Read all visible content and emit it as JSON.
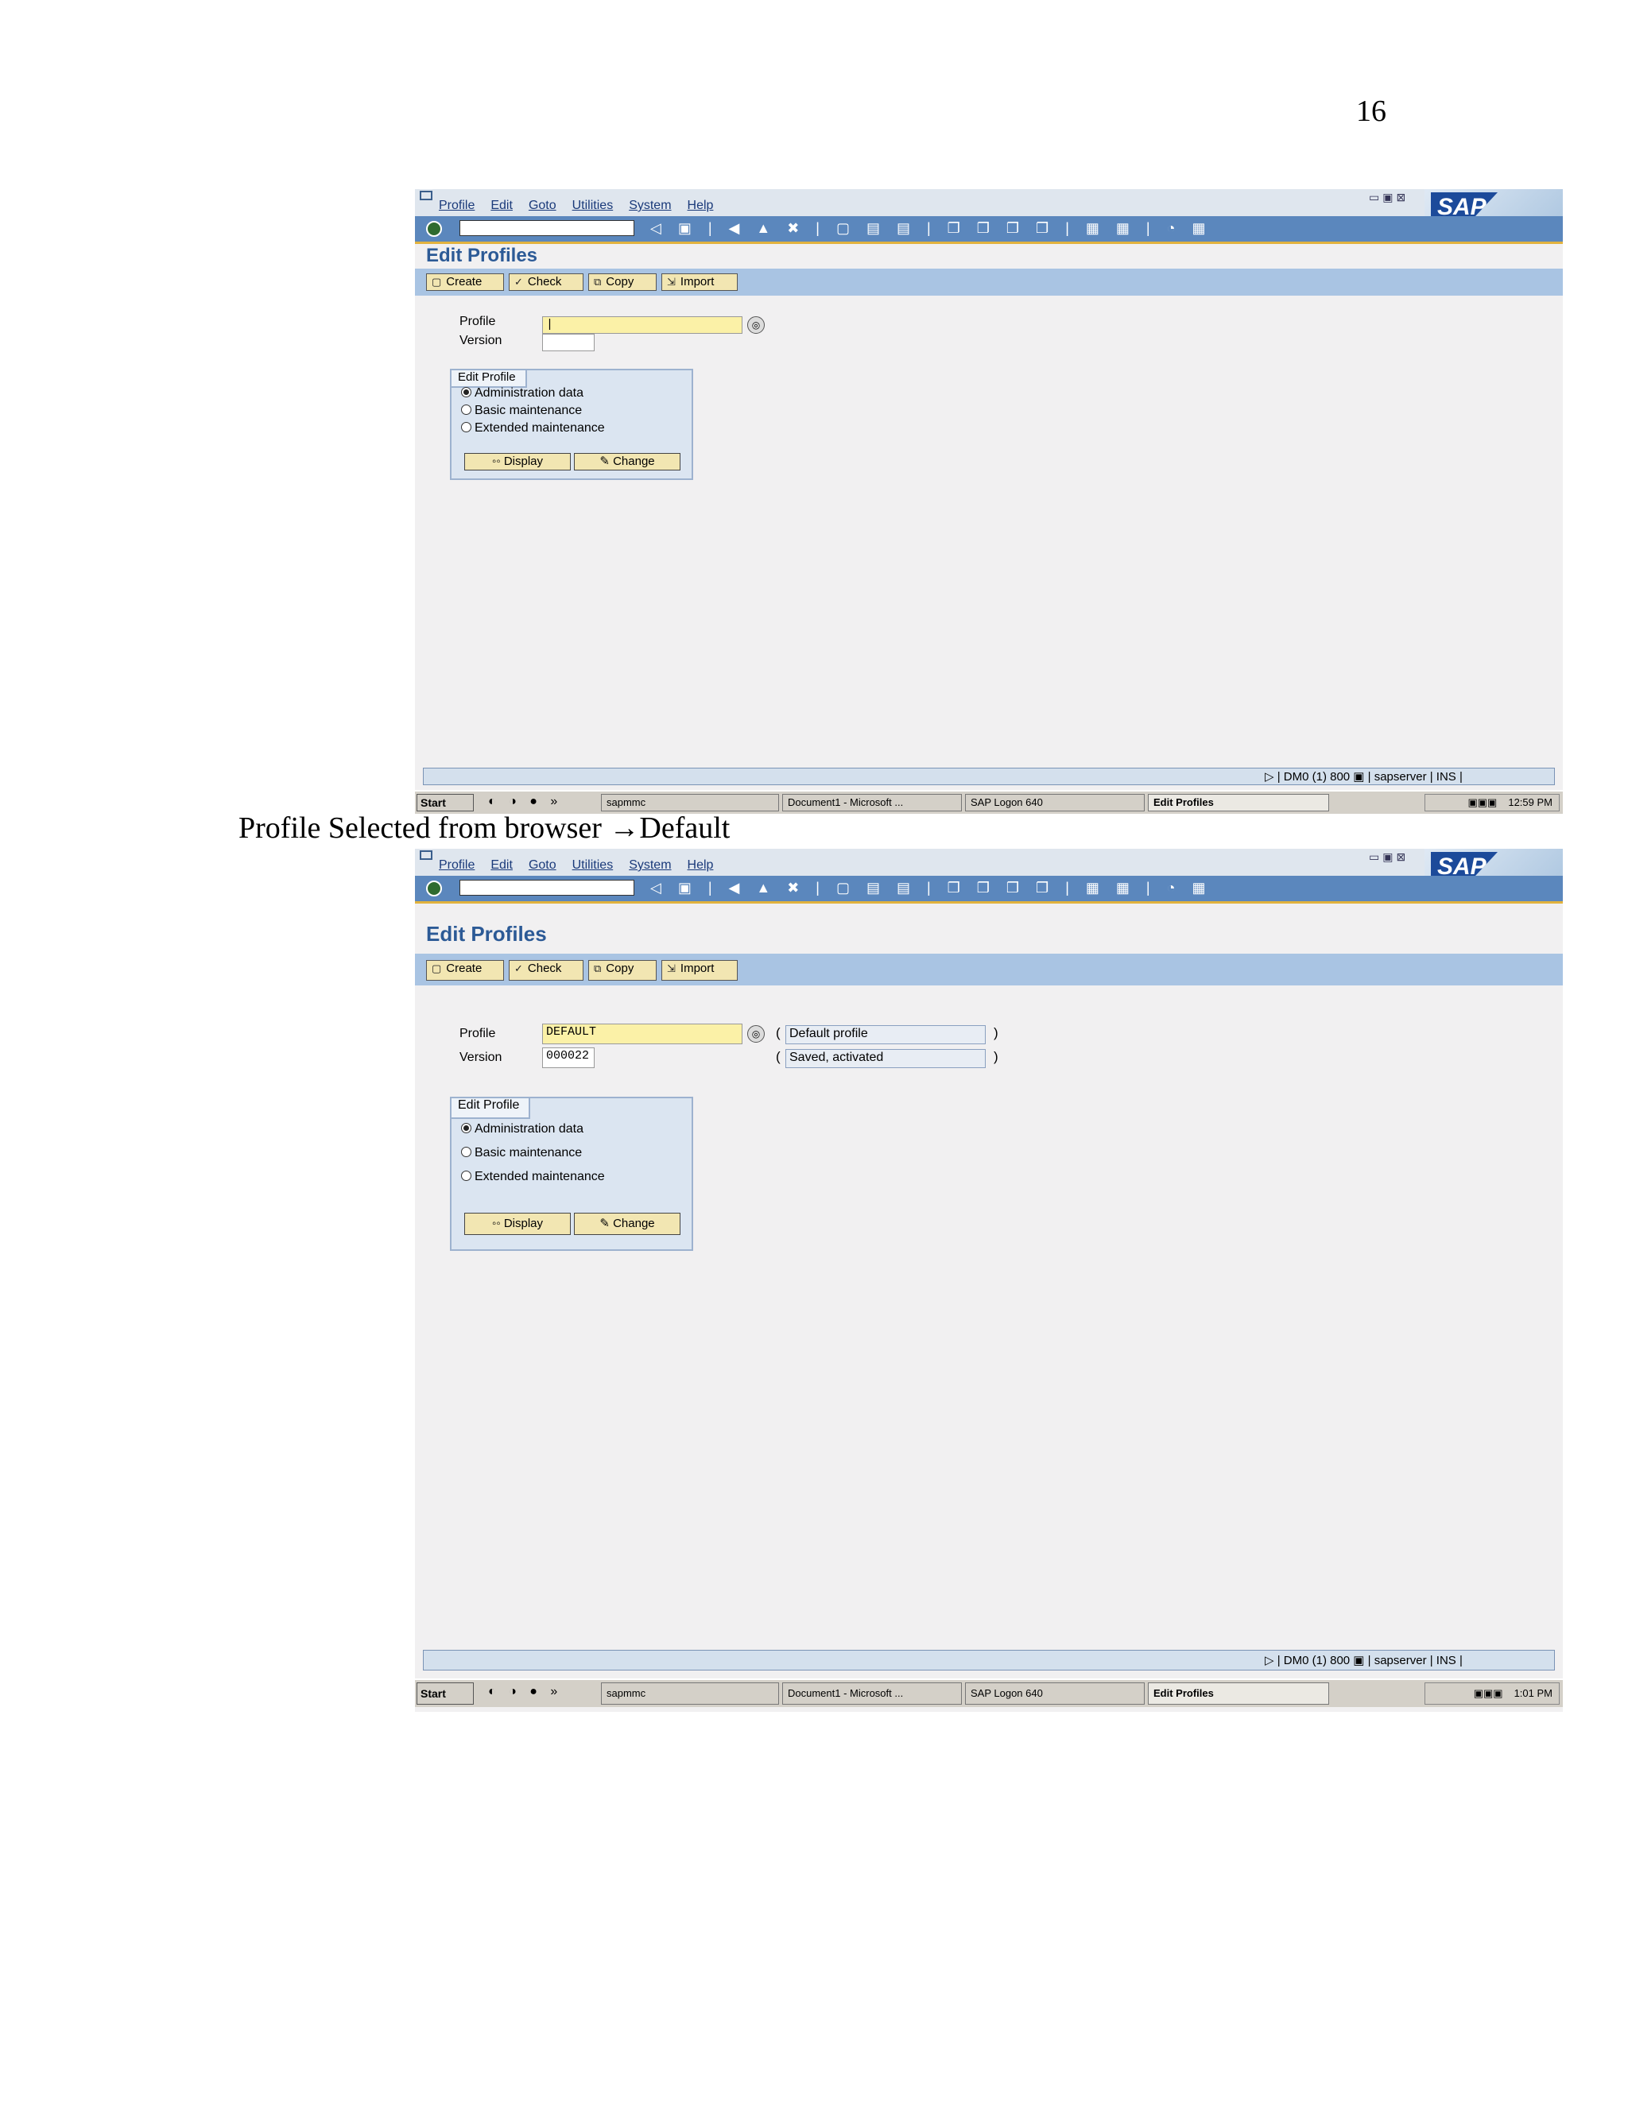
{
  "page_number": "16",
  "caption": "Profile Selected from browser →Default",
  "menu": [
    "Profile",
    "Edit",
    "Goto",
    "Utilities",
    "System",
    "Help"
  ],
  "window_controls": "▭▣⊠",
  "sap_logo": "SAP",
  "toolbar_icons": "◁ ▣ | ◀ ▲ ✖ | ▢ ▤ ▤ | ❐ ❐ ❐ ❐ | ▦ ▦ | ◔ ▦",
  "screen_title": "Edit Profiles",
  "app_buttons": {
    "create": "Create",
    "check": "Check",
    "copy": "Copy",
    "import": "Import"
  },
  "labels": {
    "profile": "Profile",
    "version": "Version"
  },
  "group": {
    "title": "Edit Profile",
    "options": [
      "Administration data",
      "Basic maintenance",
      "Extended maintenance"
    ],
    "display": "Display",
    "change": "Change"
  },
  "screen1": {
    "profile_value": "|",
    "version_value": "",
    "time": "12:59 PM"
  },
  "screen2": {
    "profile_value": "DEFAULT",
    "version_value": "000022",
    "profile_desc": "Default profile",
    "version_desc": "Saved, activated",
    "time": "1:01 PM"
  },
  "status": "▷ | DM0 (1) 800  ▣ | sapserver | INS |",
  "taskbar": {
    "start": "Start",
    "quicklaunch": "◐ ◑ ● »",
    "tasks": [
      "sapmmc",
      "Document1 - Microsoft ...",
      "SAP Logon 640",
      "Edit Profiles"
    ],
    "tray_icons": "▣▣▣"
  }
}
